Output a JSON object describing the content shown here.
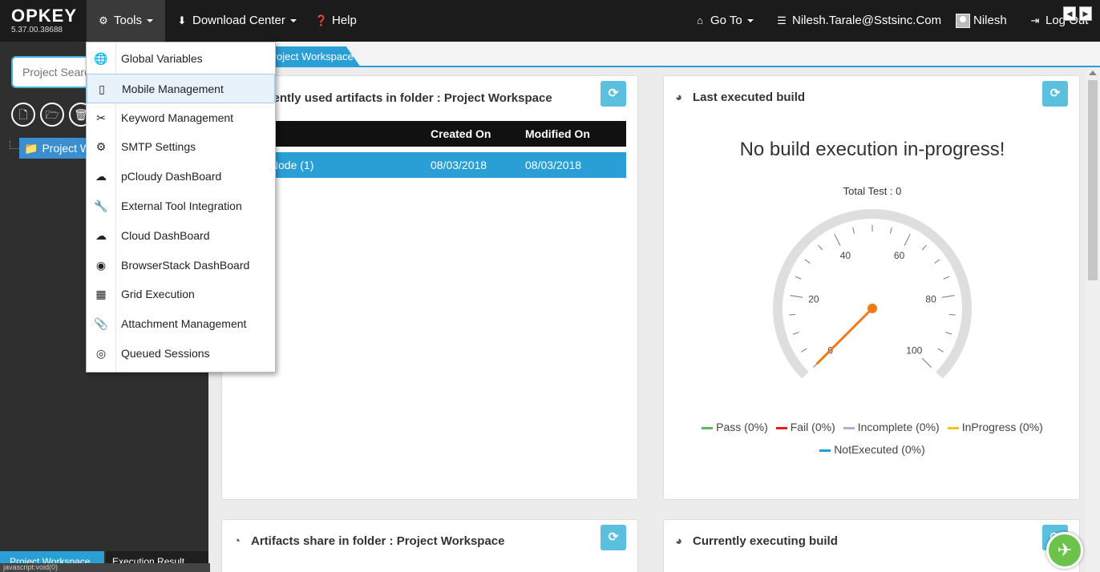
{
  "navbar": {
    "brand": "OPKEY",
    "version": "5.37.00.38688",
    "tools": "Tools",
    "download_center": "Download Center",
    "help": "Help",
    "go_to": "Go To",
    "email": "Nilesh.Tarale@Sstsinc.Com",
    "user": "Nilesh",
    "logout": "Log Out"
  },
  "sidebar": {
    "search_placeholder": "Project Search",
    "tree_node": "Project Workspace",
    "bottom_tabs": [
      "Project Workspace",
      "Execution Result"
    ],
    "status_text": "javascript:void(0)"
  },
  "tools_menu": {
    "items": [
      {
        "label": "Global Variables",
        "icon": "globe-icon"
      },
      {
        "label": "Mobile Management",
        "icon": "mobile-icon"
      },
      {
        "label": "Keyword Management",
        "icon": "keyword-icon"
      },
      {
        "label": "SMTP Settings",
        "icon": "smtp-icon"
      },
      {
        "label": "pCloudy DashBoard",
        "icon": "pcloudy-icon"
      },
      {
        "label": "External Tool Integration",
        "icon": "wrench-icon"
      },
      {
        "label": "Cloud DashBoard",
        "icon": "cloud-icon"
      },
      {
        "label": "BrowserStack DashBoard",
        "icon": "browserstack-icon"
      },
      {
        "label": "Grid Execution",
        "icon": "grid-icon"
      },
      {
        "label": "Attachment Management",
        "icon": "paperclip-icon"
      },
      {
        "label": "Queued Sessions",
        "icon": "queue-icon"
      }
    ],
    "active_index": 1
  },
  "workspace_tab": "Project Workspace",
  "panels": {
    "recent": {
      "title": "Recently used artifacts in folder : Project Workspace",
      "columns": [
        "",
        "Created On",
        "Modified On"
      ],
      "rows": [
        {
          "name": "New Node (1)",
          "created": "08/03/2018",
          "modified": "08/03/2018"
        }
      ]
    },
    "last_build": {
      "title": "Last executed build",
      "message": "No build execution in-progress!",
      "total_test": "Total Test : 0",
      "gauge_value": 0,
      "gauge_labels": [
        "0",
        "20",
        "40",
        "60",
        "80",
        "100"
      ],
      "legend": [
        {
          "label": "Pass (0%)",
          "color": "#5cb85c"
        },
        {
          "label": "Fail (0%)",
          "color": "#e0201b"
        },
        {
          "label": "Incomplete (0%)",
          "color": "#a9b6d0"
        },
        {
          "label": "InProgress (0%)",
          "color": "#f2c318"
        },
        {
          "label": "NotExecuted (0%)",
          "color": "#1e9fd6"
        }
      ]
    },
    "share": {
      "title": "Artifacts share in folder : Project Workspace"
    },
    "current": {
      "title": "Currently executing build"
    }
  },
  "colors": {
    "accent": "#2a9fd6",
    "navbar": "#1b1b1b",
    "sidebar": "#2f2f2f",
    "needle": "#ee7c16"
  }
}
